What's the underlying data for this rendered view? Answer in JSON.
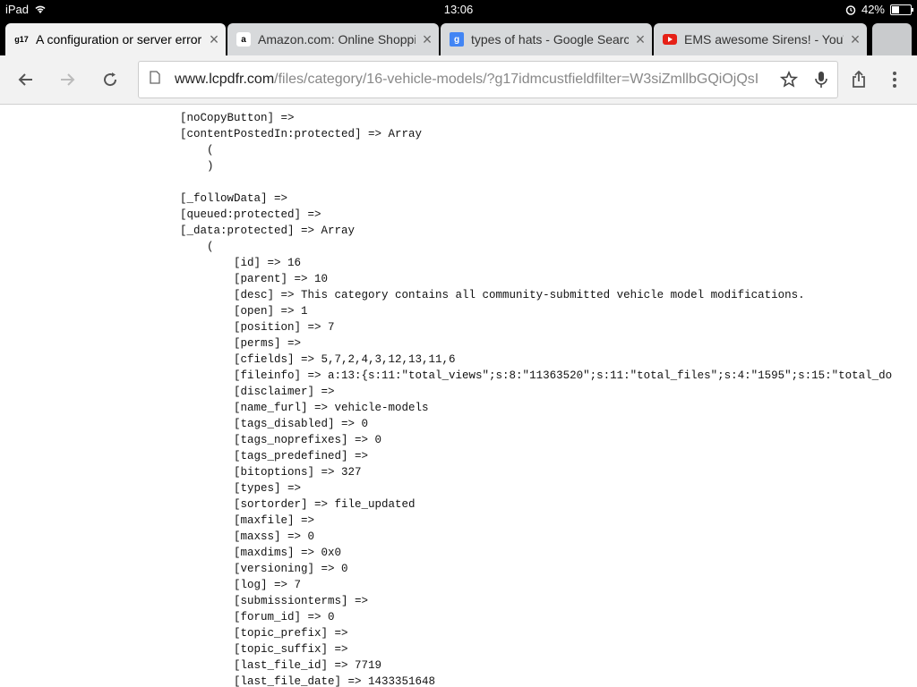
{
  "statusbar": {
    "device": "iPad",
    "time": "13:06",
    "battery": "42%"
  },
  "tabs": [
    {
      "favicon": "g17",
      "title": "A configuration or server error",
      "active": true
    },
    {
      "favicon": "amazon-icon",
      "title": "Amazon.com: Online Shopping",
      "active": false
    },
    {
      "favicon": "google-icon",
      "title": "types of hats - Google Search",
      "active": false
    },
    {
      "favicon": "youtube-icon",
      "title": "EMS awesome Sirens! - YouTube",
      "active": false
    }
  ],
  "omnibox": {
    "host": "www.lcpdfr.com",
    "path": "/files/category/16-vehicle-models/?g17idmcustfieldfilter=W3siZmllbGQiOjQsI"
  },
  "code_lines": [
    "[noCopyButton] =>",
    "[contentPostedIn:protected] => Array",
    "    (",
    "    )",
    "",
    "[_followData] =>",
    "[queued:protected] =>",
    "[_data:protected] => Array",
    "    (",
    "        [id] => 16",
    "        [parent] => 10",
    "        [desc] => This category contains all community-submitted vehicle model modifications.",
    "        [open] => 1",
    "        [position] => 7",
    "        [perms] =>",
    "        [cfields] => 5,7,2,4,3,12,13,11,6",
    "        [fileinfo] => a:13:{s:11:\"total_views\";s:8:\"11363520\";s:11:\"total_files\";s:4:\"1595\";s:15:\"total_do",
    "        [disclaimer] =>",
    "        [name_furl] => vehicle-models",
    "        [tags_disabled] => 0",
    "        [tags_noprefixes] => 0",
    "        [tags_predefined] =>",
    "        [bitoptions] => 327",
    "        [types] =>",
    "        [sortorder] => file_updated",
    "        [maxfile] =>",
    "        [maxss] => 0",
    "        [maxdims] => 0x0",
    "        [versioning] => 0",
    "        [log] => 7",
    "        [submissionterms] =>",
    "        [forum_id] => 0",
    "        [topic_prefix] =>",
    "        [topic_suffix] =>",
    "        [last_file_id] => 7719",
    "        [last_file_date] => 1433351648"
  ],
  "colors": {
    "youtube_red": "#e62117",
    "google_blue": "#4285f4"
  }
}
